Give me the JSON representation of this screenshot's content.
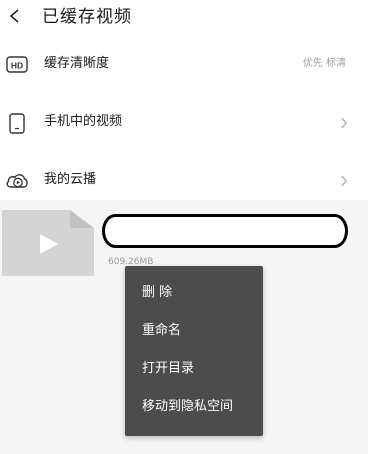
{
  "header": {
    "back_icon": "chevron-left-icon",
    "title": "已缓存视频"
  },
  "settings": [
    {
      "icon": "hd-icon",
      "label": "缓存清晰度",
      "value": "优先 标清",
      "has_chevron": false
    },
    {
      "icon": "phone-icon",
      "label": "手机中的视频",
      "value": "",
      "has_chevron": true
    },
    {
      "icon": "cloud-play-icon",
      "label": "我的云播",
      "value": "",
      "has_chevron": true
    }
  ],
  "video_item": {
    "thumbnail_icon": "video-file-icon",
    "name": "",
    "name_redacted": true,
    "size": "609.26MB"
  },
  "context_menu": {
    "items": [
      "删 除",
      "重命名",
      "打开目录",
      "移动到隐私空间"
    ]
  },
  "colors": {
    "menu_background": "#4c4c4c",
    "list_background": "#f5f5f5",
    "thumbnail": "#d4d4d4",
    "secondary_text": "#a0a0a0"
  }
}
